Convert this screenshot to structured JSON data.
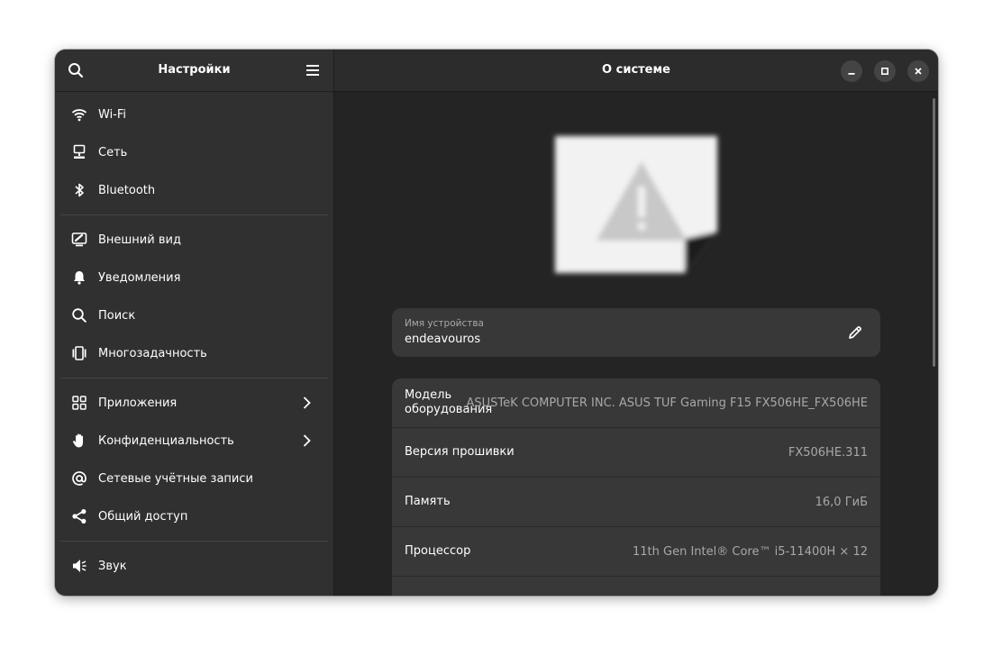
{
  "sidebar": {
    "title": "Настройки",
    "search_icon": "search-icon",
    "menu_icon": "hamburger-menu-icon",
    "groups": [
      [
        {
          "label": "Wi-Fi",
          "icon": "wifi-icon"
        },
        {
          "label": "Сеть",
          "icon": "network-icon"
        },
        {
          "label": "Bluetooth",
          "icon": "bluetooth-icon"
        }
      ],
      [
        {
          "label": "Внешний вид",
          "icon": "appearance-icon"
        },
        {
          "label": "Уведомления",
          "icon": "bell-icon"
        },
        {
          "label": "Поиск",
          "icon": "search-icon"
        },
        {
          "label": "Многозадачность",
          "icon": "multitasking-icon"
        }
      ],
      [
        {
          "label": "Приложения",
          "icon": "apps-grid-icon",
          "submenu": true
        },
        {
          "label": "Конфиденциальность",
          "icon": "hand-icon",
          "submenu": true
        },
        {
          "label": "Сетевые учётные записи",
          "icon": "at-sign-icon"
        },
        {
          "label": "Общий доступ",
          "icon": "share-icon"
        }
      ],
      [
        {
          "label": "Звук",
          "icon": "speaker-icon"
        }
      ]
    ]
  },
  "main": {
    "title": "О системе",
    "window_controls": [
      "minimize-icon",
      "maximize-icon",
      "close-icon"
    ],
    "device_name": {
      "caption": "Имя устройства",
      "value": "endeavouros"
    },
    "info_rows": [
      {
        "key": "Модель оборудования",
        "value": "ASUSTeK COMPUTER INC. ASUS TUF Gaming F15 FX506HE_FX506HE"
      },
      {
        "key": "Версия прошивки",
        "value": "FX506HE.311"
      },
      {
        "key": "Память",
        "value": "16,0 ГиБ"
      },
      {
        "key": "Процессор",
        "value": "11th Gen Intel® Core™ i5-11400H × 12"
      },
      {
        "key": "",
        "value": ""
      }
    ]
  },
  "colors": {
    "sidebar_bg": "#303030",
    "main_bg": "#242424",
    "card_bg": "#383838",
    "text": "#ffffff",
    "dim_text": "#a8a8a8"
  }
}
